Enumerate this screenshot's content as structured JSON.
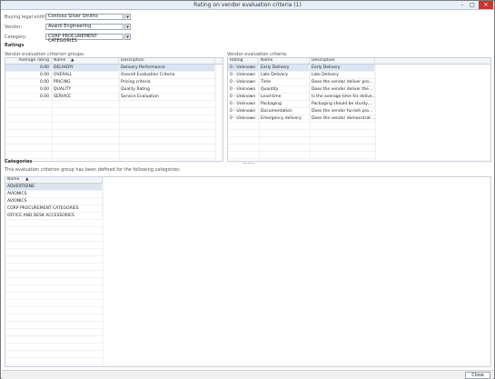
{
  "window": {
    "title": "Rating on vendor evaluation criteria (1)",
    "controls": [
      "-",
      "□",
      "✕"
    ]
  },
  "form": {
    "buying_entity": {
      "label": "Buying legal entity:",
      "value": "Contoso Silver Smiths"
    },
    "vendor": {
      "label": "Vendor:",
      "value": "Avanti Engineering"
    },
    "category": {
      "label": "Category:",
      "value": "CORP PROCUREMENT CATEGORIES"
    }
  },
  "ratings": {
    "section_title": "Ratings",
    "groups": {
      "label": "Vendor evaluation criterion groups:",
      "columns": [
        "Average rating",
        "Name",
        "Description"
      ],
      "rows": [
        {
          "avg": "0.00",
          "name": "DELIVERY",
          "desc": "Delivery Performance"
        },
        {
          "avg": "0.00",
          "name": "OVERALL",
          "desc": "Overall Evaluation Criteria"
        },
        {
          "avg": "0.00",
          "name": "PRICING",
          "desc": "Pricing criteria"
        },
        {
          "avg": "0.00",
          "name": "QUALITY",
          "desc": "Quality Rating"
        },
        {
          "avg": "0.00",
          "name": "SERVICE",
          "desc": "Service Evaluation"
        }
      ]
    },
    "criteria": {
      "label": "Vendor evaluation criteria:",
      "columns": [
        "Rating",
        "Name",
        "Description"
      ],
      "rows": [
        {
          "rating": "0 - Unknown",
          "name": "Early Delivery",
          "desc": "Early Delivery"
        },
        {
          "rating": "0 - Unknown",
          "name": "Late Delivery",
          "desc": "Late Delivery"
        },
        {
          "rating": "0 - Unknown",
          "name": "Time",
          "desc": "Does the vendor deliver pro..."
        },
        {
          "rating": "0 - Unknown",
          "name": "Quantity",
          "desc": "Does the vendor deliver the ..."
        },
        {
          "rating": "0 - Unknown",
          "name": "Lead time",
          "desc": "Is the average time for delive..."
        },
        {
          "rating": "0 - Unknown",
          "name": "Packaging",
          "desc": "Packaging should be sturdy,..."
        },
        {
          "rating": "0 - Unknown",
          "name": "Documentation",
          "desc": "Does the vendor furnish pro..."
        },
        {
          "rating": "0 - Unknown",
          "name": "Emergency delivery",
          "desc": "Does the vendor demonstrat..."
        }
      ]
    }
  },
  "categories": {
    "section_title": "Categories",
    "note": "This evaluation criterion group has been defined for the following categories:",
    "column": "Name",
    "rows": [
      "ADVERTISING",
      "AVIONICS",
      "AVIONICS",
      "CORP PROCUREMENT CATEGORIES",
      "OFFICE AND DESK ACCESSORIES"
    ]
  },
  "footer": {
    "close_label": "Close"
  }
}
